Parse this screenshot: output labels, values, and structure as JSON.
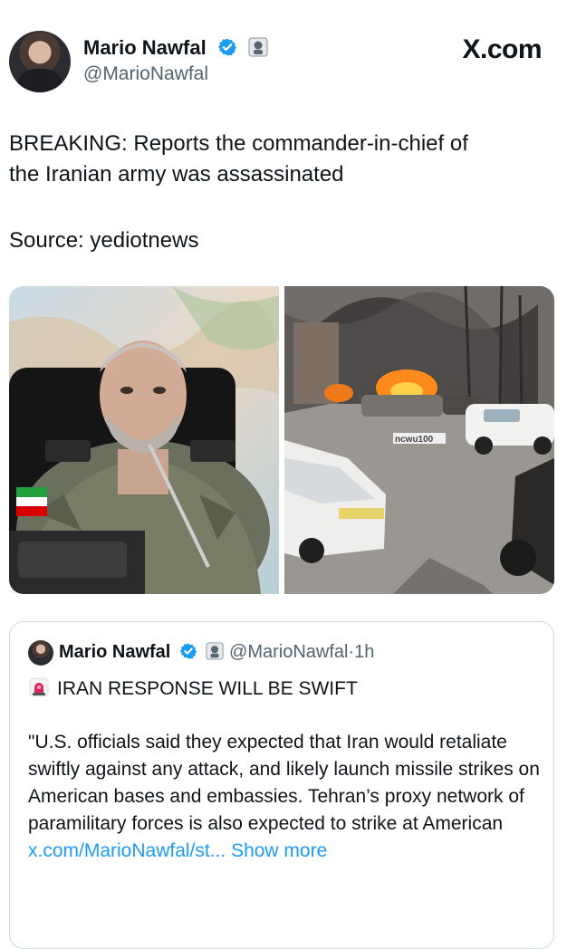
{
  "tweet": {
    "author": {
      "name": "Mario Nawfal",
      "handle": "@MarioNawfal"
    },
    "brand": "X.com",
    "text_lines": [
      "BREAKING: Reports the commander-in-chief of",
      "the Iranian army was assassinated"
    ],
    "source": "Source: yediotnews",
    "watermark": "ncwu100"
  },
  "quote": {
    "author": {
      "name": "Mario Nawfal",
      "handle": "@MarioNawfal",
      "separator": "·",
      "time": "1h"
    },
    "headline": "IRAN RESPONSE WILL BE SWIFT",
    "body": "\"U.S. officials said they expected that Iran would retaliate swiftly against any attack, and likely launch missile strikes on American bases and embassies. Tehran’s proxy network of paramilitary forces is also expected to strike at American ",
    "link": "x.com/MarioNawfal/st...",
    "show_more": "Show more"
  },
  "colors": {
    "accent": "#1d9bf0",
    "text": "#0f1419",
    "secondary": "#536471",
    "border": "#cfd9de"
  },
  "icons": [
    "verified-badge-icon",
    "affiliate-badge-icon",
    "siren-icon",
    "x-logo"
  ]
}
